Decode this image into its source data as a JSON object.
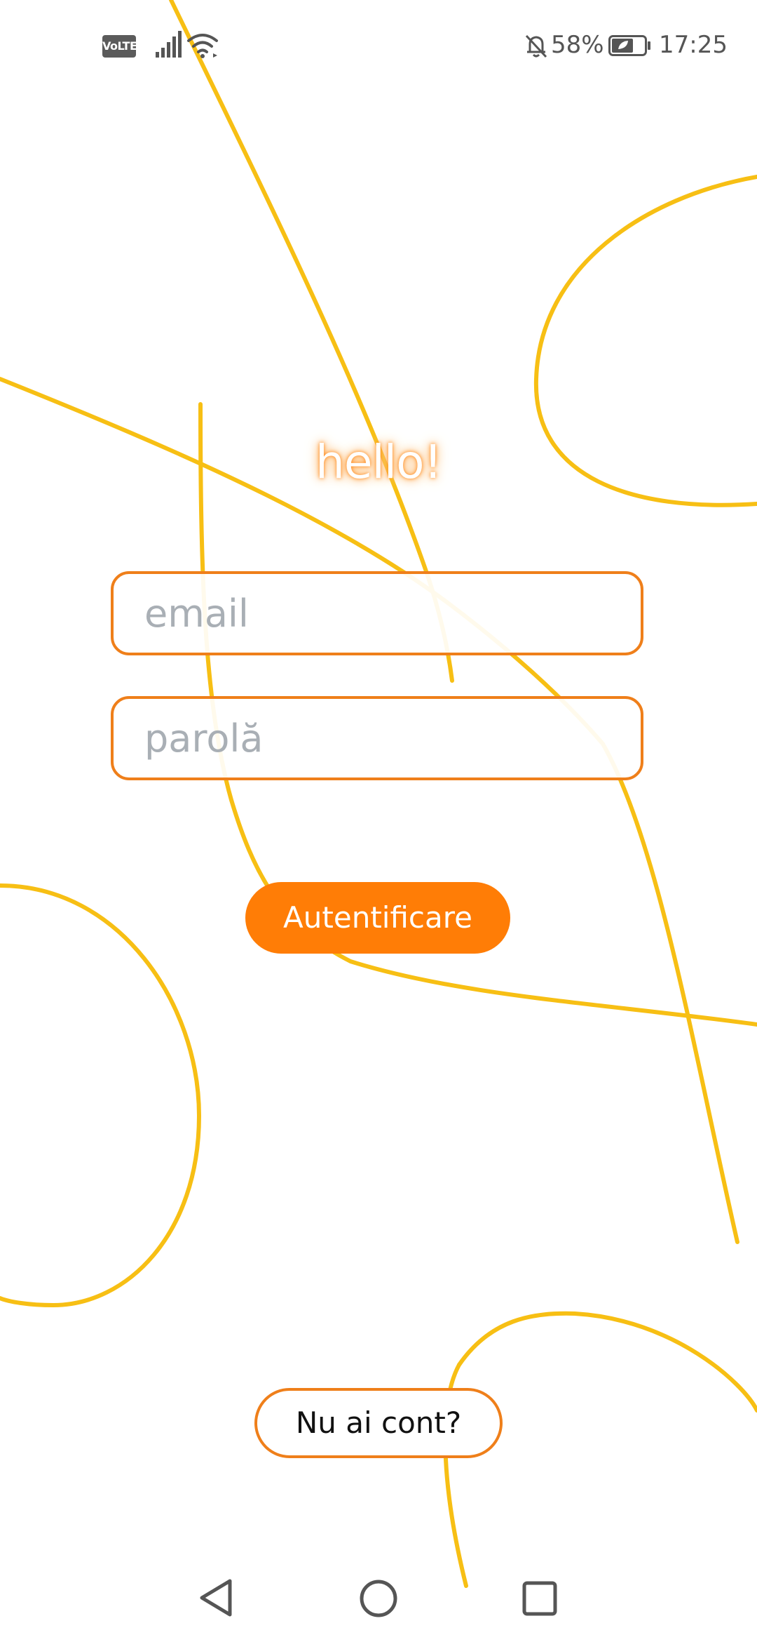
{
  "status_bar": {
    "network_badge": "VoLTE",
    "signal_icon": "signal-bars-icon",
    "wifi_icon": "wifi-icon",
    "notification_icon": "bell-off-icon",
    "battery_percent": "58%",
    "battery_icon": "battery-saver-icon",
    "time": "17:25"
  },
  "login": {
    "greeting": "hello!",
    "email_placeholder": "email",
    "password_placeholder": "parolă",
    "submit_label": "Autentificare",
    "signup_label": "Nu ai cont?"
  },
  "nav_bar": {
    "back_icon": "back-triangle-icon",
    "home_icon": "home-circle-icon",
    "recents_icon": "recents-square-icon"
  },
  "colors": {
    "accent": "#ff7d06",
    "border": "#ef7f1a",
    "decor_lines": "#f7bf14",
    "placeholder": "#a9afb5"
  }
}
